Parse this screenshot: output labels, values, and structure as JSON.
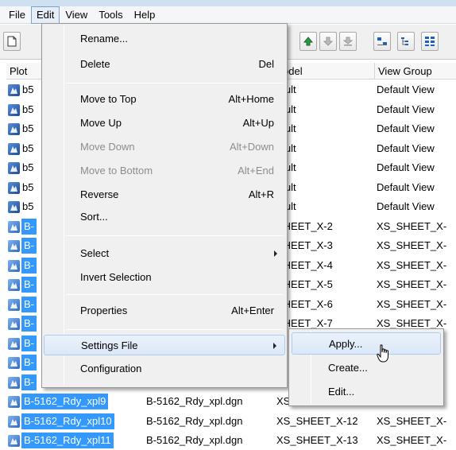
{
  "menubar": [
    "File",
    "Edit",
    "View",
    "Tools",
    "Help"
  ],
  "table": {
    "columns": [
      "Plot",
      "",
      "odel",
      "View Group"
    ],
    "rows": [
      {
        "name": "b5",
        "file": "",
        "model": "fault",
        "view": "Default View",
        "selected": false
      },
      {
        "name": "b5",
        "file": "",
        "model": "fault",
        "view": "Default View",
        "selected": false
      },
      {
        "name": "b5",
        "file": "",
        "model": "fault",
        "view": "Default View",
        "selected": false
      },
      {
        "name": "b5",
        "file": "",
        "model": "fault",
        "view": "Default View",
        "selected": false
      },
      {
        "name": "b5",
        "file": "",
        "model": "fault",
        "view": "Default View",
        "selected": false
      },
      {
        "name": "b5",
        "file": "",
        "model": "fault",
        "view": "Default View",
        "selected": false
      },
      {
        "name": "b5",
        "file": "",
        "model": "fault",
        "view": "Default View",
        "selected": false
      },
      {
        "name": "B-",
        "file": "",
        "model": "SHEET_X-2",
        "view": "XS_SHEET_X-",
        "selected": true
      },
      {
        "name": "B-",
        "file": "",
        "model": "SHEET_X-3",
        "view": "XS_SHEET_X-",
        "selected": true
      },
      {
        "name": "B-",
        "file": "",
        "model": "SHEET_X-4",
        "view": "XS_SHEET_X-",
        "selected": true
      },
      {
        "name": "B-",
        "file": "",
        "model": "SHEET_X-5",
        "view": "XS_SHEET_X-",
        "selected": true
      },
      {
        "name": "B-",
        "file": "",
        "model": "SHEET_X-6",
        "view": "XS_SHEET_X-",
        "selected": true
      },
      {
        "name": "B-",
        "file": "",
        "model": "SHEET_X-7",
        "view": "XS_SHEET_X-",
        "selected": true
      },
      {
        "name": "B-",
        "file": "",
        "model": "",
        "view": "X-",
        "selected": true
      },
      {
        "name": "B-",
        "file": "",
        "model": "",
        "view": "X-",
        "selected": true
      },
      {
        "name": "B-",
        "file": "",
        "model": "",
        "view": "X-",
        "selected": true
      },
      {
        "name": "B-5162_Rdy_xpl9",
        "file": "B-5162_Rdy_xpl.dgn",
        "model": "XS",
        "view": "X-",
        "selected": true
      },
      {
        "name": "B-5162_Rdy_xpl10",
        "file": "B-5162_Rdy_xpl.dgn",
        "model": "XS_SHEET_X-12",
        "view": "XS_SHEET_X-",
        "selected": true
      },
      {
        "name": "B-5162_Rdy_xpl11",
        "file": "B-5162_Rdy_xpl.dgn",
        "model": "XS_SHEET_X-13",
        "view": "XS_SHEET_X-",
        "selected": true
      }
    ]
  },
  "edit_menu": {
    "items": [
      {
        "label": "Rename...",
        "shortcut": "",
        "disabled": false
      },
      {
        "label": "Delete",
        "shortcut": "Del",
        "disabled": false
      },
      {
        "label": "Move to Top",
        "shortcut": "Alt+Home",
        "disabled": false
      },
      {
        "label": "Move Up",
        "shortcut": "Alt+Up",
        "disabled": false
      },
      {
        "label": "Move Down",
        "shortcut": "Alt+Down",
        "disabled": true
      },
      {
        "label": "Move to Bottom",
        "shortcut": "Alt+End",
        "disabled": true
      },
      {
        "label": "Reverse",
        "shortcut": "Alt+R",
        "disabled": false
      },
      {
        "label": "Sort...",
        "shortcut": "",
        "disabled": false
      },
      {
        "label": "Select",
        "shortcut": "",
        "disabled": false
      },
      {
        "label": "Invert Selection",
        "shortcut": "",
        "disabled": false
      },
      {
        "label": "Properties",
        "shortcut": "Alt+Enter",
        "disabled": false
      },
      {
        "label": "Settings File",
        "shortcut": "",
        "disabled": false
      },
      {
        "label": "Configuration",
        "shortcut": "",
        "disabled": false
      }
    ]
  },
  "settings_submenu": {
    "items": [
      "Apply...",
      "Create...",
      "Edit..."
    ]
  },
  "colors": {
    "selection": "#3399ff",
    "menu_highlight": "#dbe8f7"
  }
}
